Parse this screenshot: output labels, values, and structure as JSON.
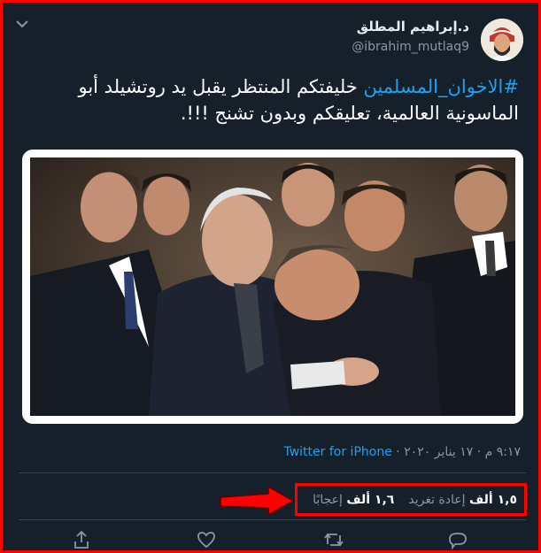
{
  "tweet": {
    "display_name": "د.إبراهيم المطلق",
    "handle": "@ibrahim_mutlaq9",
    "hashtag": "#الاخوان_المسلمين",
    "body": " خليفتكم المنتظر يقبل يد روتشيلد أبو الماسونية العالمية، تعليقكم وبدون تشنج !!!.",
    "time": "٩:١٧ م",
    "date": "١٧ يناير ٢٠٢٠",
    "source": "Twitter for iPhone",
    "dot": "·"
  },
  "stats": {
    "retweets_count": "١,٥ ألف",
    "retweets_label": "إعادة تغريد",
    "likes_count": "١,٦ ألف",
    "likes_label": "إعجابًا"
  },
  "icons": [
    "chevron-down-icon",
    "reply-icon",
    "retweet-icon",
    "like-icon",
    "share-icon"
  ],
  "colors": {
    "background": "#15202b",
    "accent": "#1da1f2",
    "highlight": "#ff0000"
  }
}
